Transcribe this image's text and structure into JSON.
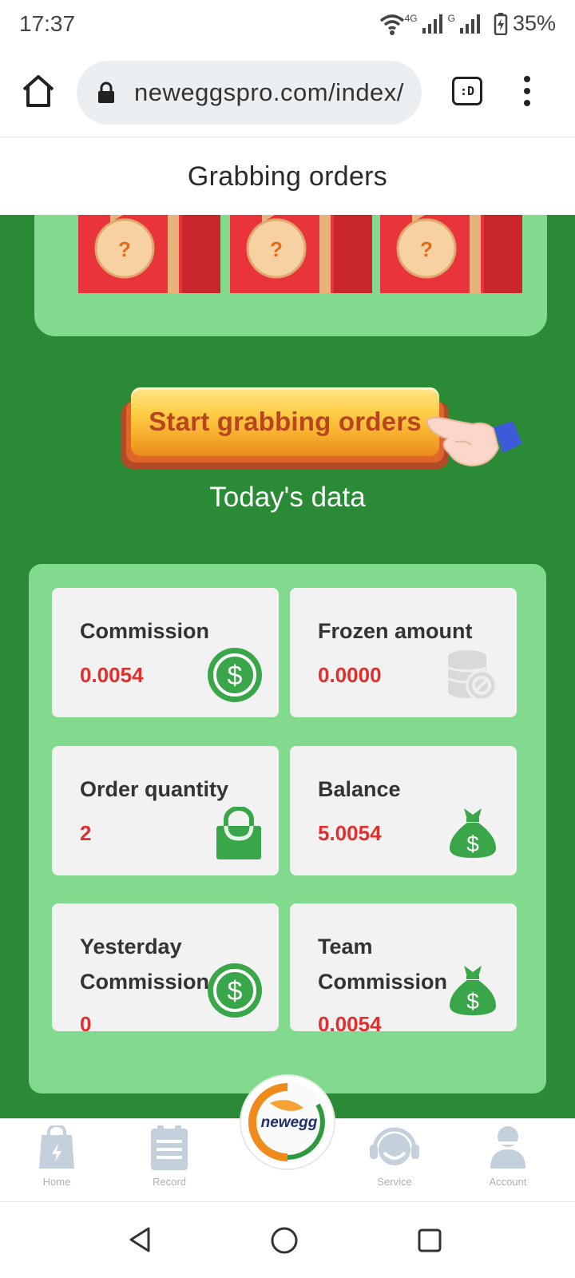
{
  "status_bar": {
    "time": "17:37",
    "network_4g": "4G",
    "network_g": "G",
    "battery": "35%"
  },
  "browser": {
    "url": "neweggspro.com/index/",
    "tab_switcher_label": ":D"
  },
  "header": {
    "title": "Grabbing orders"
  },
  "gifts": {
    "tag_mark": "?"
  },
  "main": {
    "start_button_label": "Start grabbing orders",
    "today_title": "Today's data"
  },
  "stats": [
    {
      "label": "Commission",
      "value": "0.0054",
      "icon": "dollar-coin-icon"
    },
    {
      "label": "Frozen amount",
      "value": "0.0000",
      "icon": "frozen-coins-icon"
    },
    {
      "label": "Order quantity",
      "value": "2",
      "icon": "shopping-bag-icon"
    },
    {
      "label": "Balance",
      "value": "5.0054",
      "icon": "money-bag-icon"
    },
    {
      "label": "Yesterday Commission",
      "value": "0",
      "icon": "dollar-coin-icon"
    },
    {
      "label": "Team Commission",
      "value": "0.0054",
      "icon": "money-bag-icon"
    }
  ],
  "bottom_nav": {
    "items": [
      {
        "label": "Home",
        "icon": "home-bag-icon"
      },
      {
        "label": "Record",
        "icon": "record-clipboard-icon"
      },
      {
        "label": "newegg",
        "icon": "newegg-logo"
      },
      {
        "label": "Service",
        "icon": "headset-icon"
      },
      {
        "label": "Account",
        "icon": "user-icon"
      }
    ]
  },
  "colors": {
    "main_green": "#2a8a35",
    "panel_green": "#81da8d",
    "value_red": "#e0302e",
    "icon_green": "#3aa64a"
  }
}
